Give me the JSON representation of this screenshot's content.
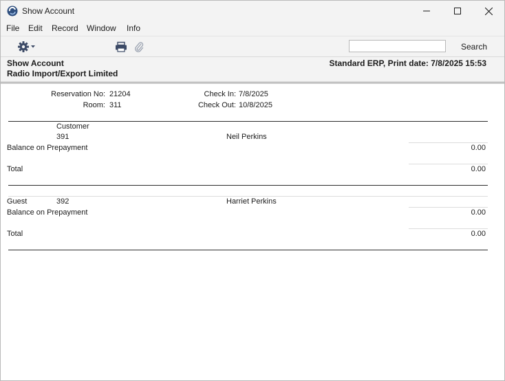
{
  "window": {
    "title": "Show Account",
    "controls": {
      "minimize": "minimize",
      "maximize": "maximize",
      "close": "close"
    }
  },
  "menu": [
    "File",
    "Edit",
    "Record",
    "Window",
    "Info"
  ],
  "toolbar": {
    "gear_icon": "gear-icon",
    "print_icon": "printer-icon",
    "attach_icon": "paperclip-icon",
    "search_value": "",
    "search_placeholder": "",
    "search_label": "Search"
  },
  "report": {
    "title": "Show Account",
    "company": "Radio Import/Export Limited",
    "header_right": "Standard ERP, Print date: 7/8/2025 15:53",
    "reservation_label": "Reservation No:",
    "reservation_no": "21204",
    "room_label": "Room:",
    "room": "311",
    "checkin_label": "Check In:",
    "checkin": "7/8/2025",
    "checkout_label": "Check Out:",
    "checkout": "10/8/2025",
    "customer_section": {
      "heading": "Customer",
      "code": "391",
      "name": "Neil Perkins",
      "balance_label": "Balance on Prepayment",
      "balance": "0.00",
      "total_label": "Total",
      "total": "0.00"
    },
    "guest_section": {
      "label": "Guest",
      "code": "392",
      "name": "Harriet Perkins",
      "balance_label": "Balance on Prepayment",
      "balance": "0.00",
      "total_label": "Total",
      "total": "0.00"
    }
  }
}
